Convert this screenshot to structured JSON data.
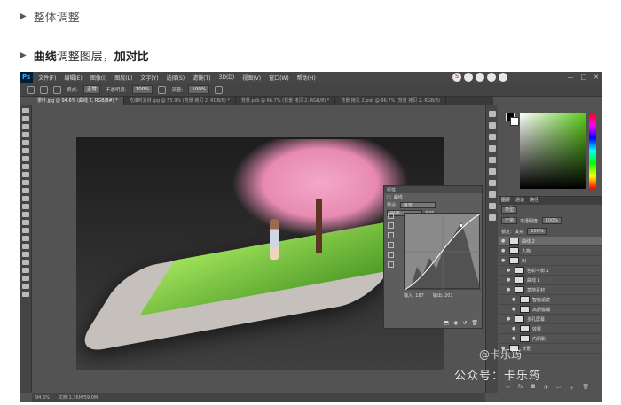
{
  "bullets": [
    {
      "text": "整体调整"
    },
    {
      "parts": [
        "曲线",
        "调整图层，",
        "加对比"
      ]
    }
  ],
  "photoshop": {
    "logo": "Ps",
    "menu": [
      "文件(F)",
      "编辑(E)",
      "图像(I)",
      "图层(L)",
      "文字(Y)",
      "选择(S)",
      "滤镜(T)",
      "3D(D)",
      "视图(V)",
      "窗口(W)",
      "帮助(H)"
    ],
    "window_controls": [
      "—",
      "□",
      "✕"
    ],
    "options": {
      "mode_label": "模式:",
      "mode_value": "正常",
      "opacity_label": "不透明度:",
      "opacity_value": "100%",
      "flow_label": "流量:",
      "flow_value": "100%"
    },
    "tabs": [
      "茶叶.jpg @ 94.6% (曲线 2, RGB/8#) *",
      "吃谁时素材.jpg @ 55.9% (背景 拷贝 2, RGB/8) *",
      "背景.psb @ 66.7% (背景 拷贝 2, RGB/8) *",
      "背景 拷贝 2.psb @ 66.7% (背景 拷贝 2, RGB/8)"
    ],
    "curves": {
      "title": "属性",
      "panel": "曲线",
      "preset_label": "预设:",
      "preset_value": "自定",
      "channel_value": "RGB",
      "auto_label": "自动",
      "input_label": "输入:",
      "input_value": "187",
      "output_label": "输出:",
      "output_value": "201"
    },
    "layers": {
      "tabs": [
        "图层",
        "通道",
        "路径"
      ],
      "kind_value": "类型",
      "blend_value": "正常",
      "opacity_label": "不透明度:",
      "opacity_value": "100%",
      "lock_label": "锁定:",
      "fill_label": "填充:",
      "fill_value": "100%",
      "items": [
        {
          "name": "曲线 2",
          "selected": true,
          "indent": 0
        },
        {
          "name": "人物",
          "indent": 0
        },
        {
          "name": "树",
          "indent": 0
        },
        {
          "name": "色彩平衡 1",
          "indent": 1
        },
        {
          "name": "曲线 1",
          "indent": 1
        },
        {
          "name": "草地素材",
          "indent": 1
        },
        {
          "name": "智能滤镜",
          "indent": 2
        },
        {
          "name": "高斯模糊",
          "indent": 2
        },
        {
          "name": "多孔屏幕",
          "indent": 1
        },
        {
          "name": "效果",
          "indent": 2
        },
        {
          "name": "内阴影",
          "indent": 2
        },
        {
          "name": "背景",
          "indent": 0
        }
      ]
    },
    "status": {
      "zoom": "94.6%",
      "doc": "文档:1.36M/59.0M"
    }
  },
  "watermarks": {
    "small": "@卡乐筠",
    "large": "公众号：卡乐筠"
  }
}
